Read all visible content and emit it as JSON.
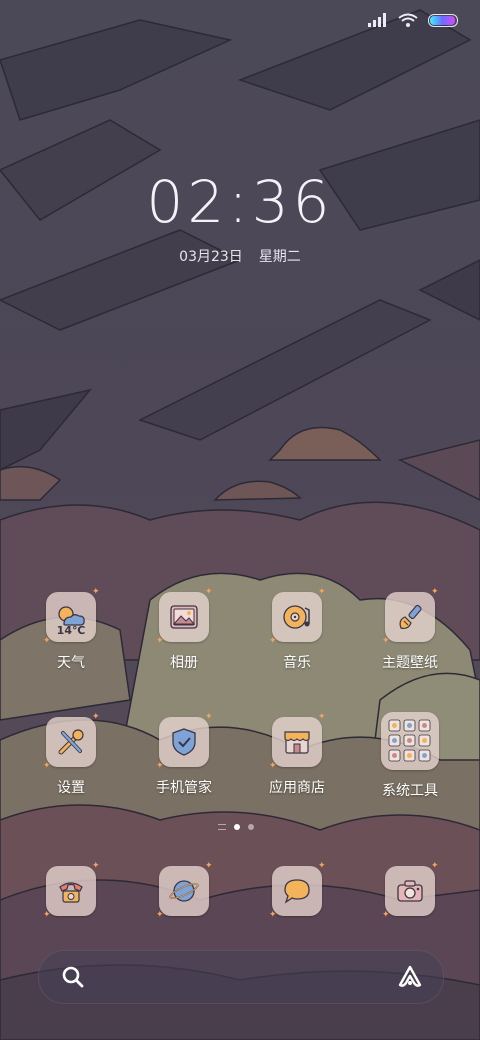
{
  "status_bar": {
    "signal_icon": "signal-bars-icon",
    "wifi_icon": "wifi-icon",
    "battery_icon": "battery-icon",
    "battery_level": 0.9
  },
  "lock": {
    "time": "02:36",
    "date": "03月23日",
    "weekday": "星期二"
  },
  "apps": [
    {
      "label": "天气",
      "icon": "weather-icon",
      "temp": "14℃"
    },
    {
      "label": "相册",
      "icon": "gallery-icon"
    },
    {
      "label": "音乐",
      "icon": "music-icon"
    },
    {
      "label": "主题壁纸",
      "icon": "theme-brush-icon"
    },
    {
      "label": "设置",
      "icon": "settings-tools-icon"
    },
    {
      "label": "手机管家",
      "icon": "security-shield-icon"
    },
    {
      "label": "应用商店",
      "icon": "app-store-icon"
    },
    {
      "label": "系统工具",
      "icon": "system-tools-folder-icon"
    }
  ],
  "dock": [
    {
      "icon": "phone-icon"
    },
    {
      "icon": "browser-planet-icon"
    },
    {
      "icon": "messages-icon"
    },
    {
      "icon": "camera-icon"
    }
  ],
  "pager": {
    "pages": 2,
    "active": 1
  },
  "searchbar": {
    "search_icon": "search-icon",
    "assistant_icon": "assistant-icon"
  },
  "colors": {
    "icon_tile": "#e8d6d0",
    "accent_orange": "#f2b35b",
    "sparkle": "#f6a35c"
  }
}
